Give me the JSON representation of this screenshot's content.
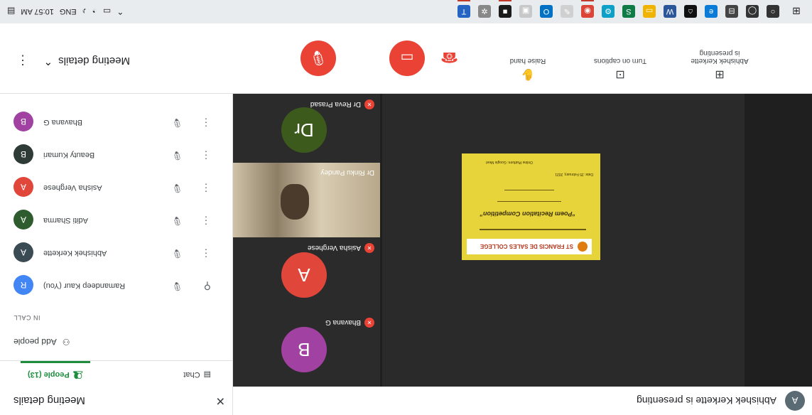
{
  "taskbar": {
    "time": "10:57 AM",
    "lang": "ENG",
    "apps": [
      {
        "name": "search-app",
        "color": "#333333",
        "glyph": "○",
        "active": false
      },
      {
        "name": "cortana-app",
        "color": "#333333",
        "glyph": "◯",
        "active": false
      },
      {
        "name": "taskview-app",
        "color": "#444444",
        "glyph": "⊟",
        "active": false
      },
      {
        "name": "edge-app",
        "color": "#0a7bd6",
        "glyph": "e",
        "active": false
      },
      {
        "name": "store-app",
        "color": "#111111",
        "glyph": "⌂",
        "active": false
      },
      {
        "name": "word-app",
        "color": "#2b579a",
        "glyph": "W",
        "active": false
      },
      {
        "name": "explorer-app",
        "color": "#f0b400",
        "glyph": "▭",
        "active": false
      },
      {
        "name": "sheets-app",
        "color": "#0f7b45",
        "glyph": "S",
        "active": false
      },
      {
        "name": "settings-app",
        "color": "#0aa0c8",
        "glyph": "⚙",
        "active": false
      },
      {
        "name": "chrome-app",
        "color": "#db4437",
        "glyph": "◉",
        "active": true
      },
      {
        "name": "paint-app",
        "color": "#d0d0d0",
        "glyph": "✎",
        "active": false
      },
      {
        "name": "outlook-app",
        "color": "#0072c6",
        "glyph": "O",
        "active": false
      },
      {
        "name": "photos-app",
        "color": "#c8c8c8",
        "glyph": "▣",
        "active": false
      },
      {
        "name": "sticky-app",
        "color": "#1b1b1b",
        "glyph": "■",
        "active": true
      },
      {
        "name": "gear-app",
        "color": "#888888",
        "glyph": "✲",
        "active": false
      },
      {
        "name": "teams-app",
        "color": "#2664c3",
        "glyph": "T",
        "active": true
      }
    ]
  },
  "controls": {
    "meeting_details": "Meeting details",
    "raise_hand": "Raise hand",
    "captions": "Turn on captions",
    "presenting_line1": "Abhishek Kerkette",
    "presenting_line2": "is presenting"
  },
  "stage": {
    "presenting_text": "Abhishek Kerkette is presenting",
    "presenting_initial": "A",
    "document": {
      "college": "ST FRANCIS DE SALES COLLEGE",
      "title": "“Poem Recitation Competition”",
      "date": "Date: 25 February, 2021",
      "venue": "Online Platform: Google Meet"
    },
    "tiles": [
      {
        "initial": "B",
        "name": "Bhavana G",
        "color": "#a142a3"
      },
      {
        "initial": "A",
        "name": "Asisha Verghese",
        "color": "#e0463a"
      },
      {
        "initial": "",
        "name": "Dr Rinku Pandey",
        "color": ""
      },
      {
        "initial": "Dr",
        "name": "Dr Reva Prasad",
        "color": "#3d5a1d"
      }
    ]
  },
  "panel": {
    "title": "Meeting details",
    "tab_people": "People (13)",
    "tab_chat": "Chat",
    "add_people": "Add people",
    "in_call": "IN CALL",
    "people": [
      {
        "initial": "R",
        "name": "Ramandeep Kaur (You)",
        "color": "#4285f4"
      },
      {
        "initial": "A",
        "name": "Abhishek Kerkette",
        "color": "#3a4b53"
      },
      {
        "initial": "A",
        "name": "Aditi Sharma",
        "color": "#2e5c2e"
      },
      {
        "initial": "A",
        "name": "Asisha Verghese",
        "color": "#e0463a"
      },
      {
        "initial": "B",
        "name": "Beauty Kumari",
        "color": "#2f3b36"
      },
      {
        "initial": "B",
        "name": "Bhavana G",
        "color": "#a142a3"
      }
    ]
  }
}
